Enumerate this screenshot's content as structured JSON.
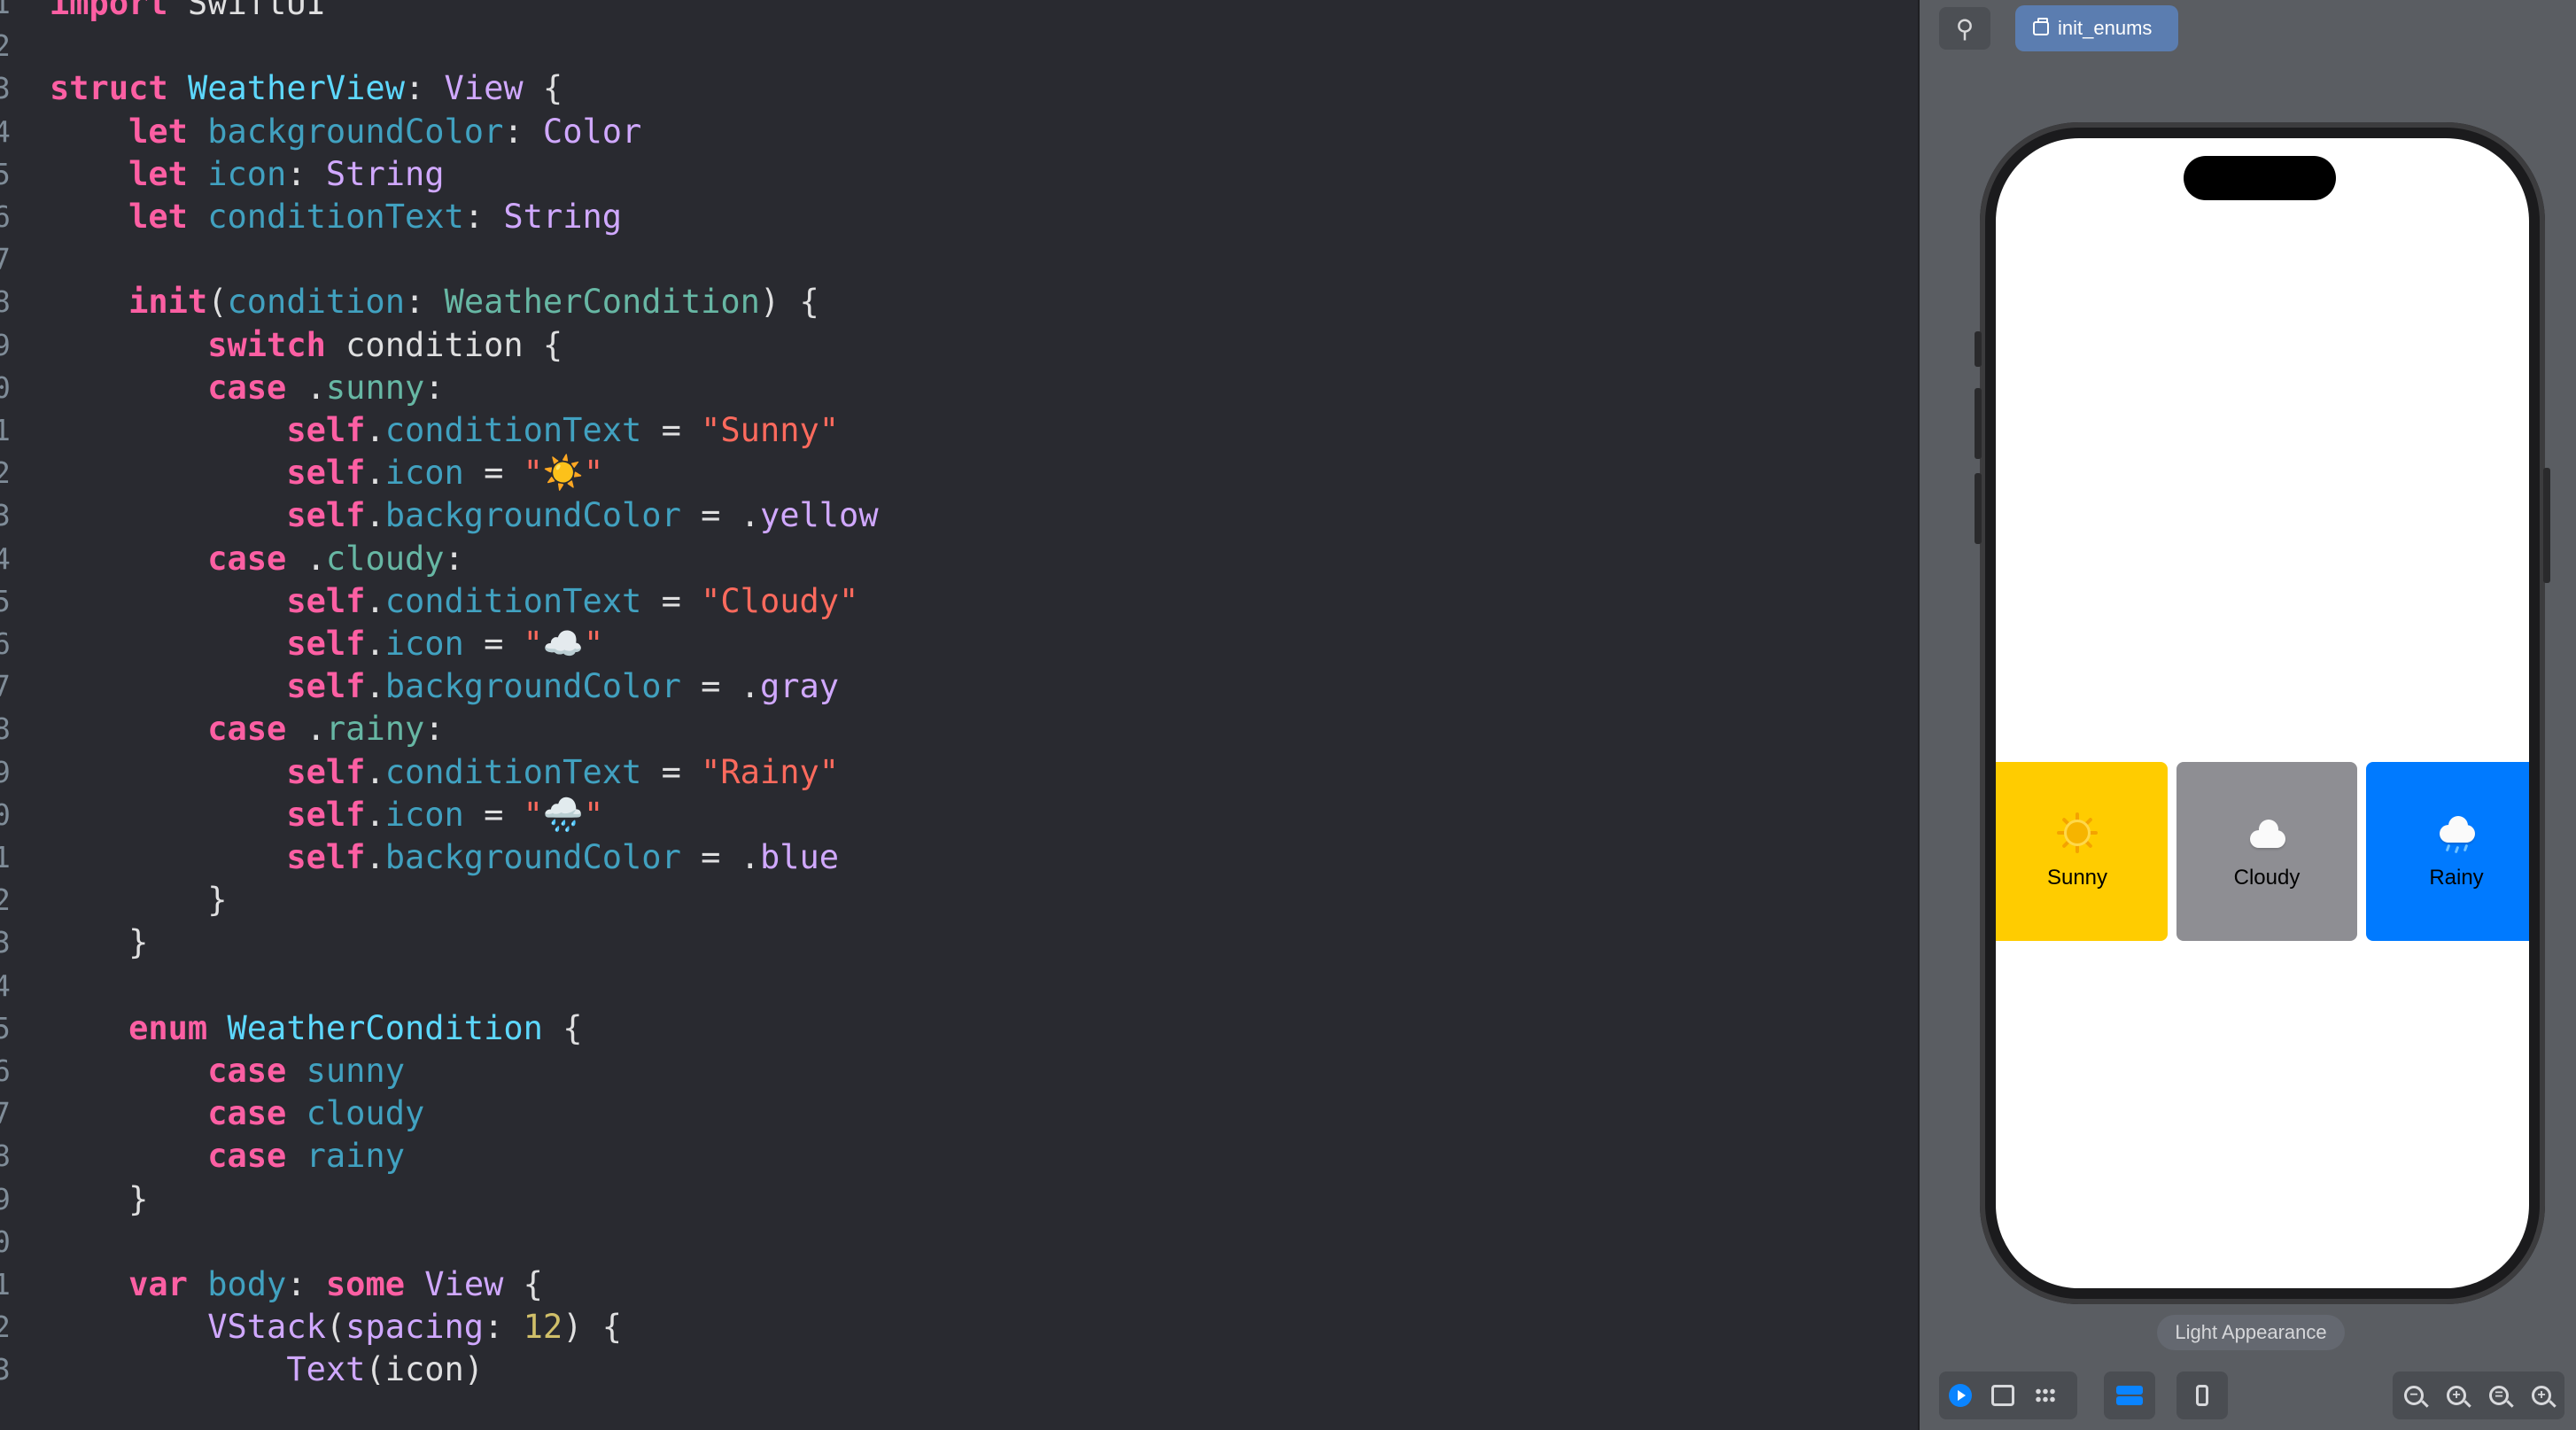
{
  "editor": {
    "lines": [
      {
        "num": "1",
        "parts": [
          {
            "t": "kw",
            "v": "import"
          },
          {
            "t": "pl",
            "v": " SwiftUI"
          }
        ]
      },
      {
        "num": "2",
        "parts": []
      },
      {
        "num": "3",
        "parts": [
          {
            "t": "kw",
            "v": "struct"
          },
          {
            "t": "pl",
            "v": " "
          },
          {
            "t": "tn",
            "v": "WeatherView"
          },
          {
            "t": "pl",
            "v": ": "
          },
          {
            "t": "ty",
            "v": "View"
          },
          {
            "t": "pl",
            "v": " {"
          }
        ]
      },
      {
        "num": "4",
        "parts": [
          {
            "t": "pl",
            "v": "    "
          },
          {
            "t": "kw",
            "v": "let"
          },
          {
            "t": "pl",
            "v": " "
          },
          {
            "t": "pr",
            "v": "backgroundColor"
          },
          {
            "t": "pl",
            "v": ": "
          },
          {
            "t": "ty",
            "v": "Color"
          }
        ]
      },
      {
        "num": "5",
        "parts": [
          {
            "t": "pl",
            "v": "    "
          },
          {
            "t": "kw",
            "v": "let"
          },
          {
            "t": "pl",
            "v": " "
          },
          {
            "t": "pr",
            "v": "icon"
          },
          {
            "t": "pl",
            "v": ": "
          },
          {
            "t": "ty",
            "v": "String"
          }
        ]
      },
      {
        "num": "6",
        "parts": [
          {
            "t": "pl",
            "v": "    "
          },
          {
            "t": "kw",
            "v": "let"
          },
          {
            "t": "pl",
            "v": " "
          },
          {
            "t": "pr",
            "v": "conditionText"
          },
          {
            "t": "pl",
            "v": ": "
          },
          {
            "t": "ty",
            "v": "String"
          }
        ]
      },
      {
        "num": "7",
        "parts": []
      },
      {
        "num": "8",
        "parts": [
          {
            "t": "pl",
            "v": "    "
          },
          {
            "t": "kw",
            "v": "init"
          },
          {
            "t": "pl",
            "v": "("
          },
          {
            "t": "pr",
            "v": "condition"
          },
          {
            "t": "pl",
            "v": ": "
          },
          {
            "t": "fn",
            "v": "WeatherCondition"
          },
          {
            "t": "pl",
            "v": ") {"
          }
        ]
      },
      {
        "num": "9",
        "parts": [
          {
            "t": "pl",
            "v": "        "
          },
          {
            "t": "kw",
            "v": "switch"
          },
          {
            "t": "pl",
            "v": " condition {"
          }
        ]
      },
      {
        "num": "0",
        "parts": [
          {
            "t": "pl",
            "v": "        "
          },
          {
            "t": "kw",
            "v": "case"
          },
          {
            "t": "pl",
            "v": " ."
          },
          {
            "t": "fn",
            "v": "sunny"
          },
          {
            "t": "pl",
            "v": ":"
          }
        ]
      },
      {
        "num": "1",
        "parts": [
          {
            "t": "pl",
            "v": "            "
          },
          {
            "t": "kw",
            "v": "self"
          },
          {
            "t": "pl",
            "v": "."
          },
          {
            "t": "pr",
            "v": "conditionText"
          },
          {
            "t": "pl",
            "v": " = "
          },
          {
            "t": "st",
            "v": "\"Sunny\""
          }
        ]
      },
      {
        "num": "2",
        "parts": [
          {
            "t": "pl",
            "v": "            "
          },
          {
            "t": "kw",
            "v": "self"
          },
          {
            "t": "pl",
            "v": "."
          },
          {
            "t": "pr",
            "v": "icon"
          },
          {
            "t": "pl",
            "v": " = "
          },
          {
            "t": "st",
            "v": "\"☀️\""
          }
        ]
      },
      {
        "num": "3",
        "parts": [
          {
            "t": "pl",
            "v": "            "
          },
          {
            "t": "kw",
            "v": "self"
          },
          {
            "t": "pl",
            "v": "."
          },
          {
            "t": "pr",
            "v": "backgroundColor"
          },
          {
            "t": "pl",
            "v": " = ."
          },
          {
            "t": "en",
            "v": "yellow"
          }
        ]
      },
      {
        "num": "4",
        "parts": [
          {
            "t": "pl",
            "v": "        "
          },
          {
            "t": "kw",
            "v": "case"
          },
          {
            "t": "pl",
            "v": " ."
          },
          {
            "t": "fn",
            "v": "cloudy"
          },
          {
            "t": "pl",
            "v": ":"
          }
        ]
      },
      {
        "num": "5",
        "parts": [
          {
            "t": "pl",
            "v": "            "
          },
          {
            "t": "kw",
            "v": "self"
          },
          {
            "t": "pl",
            "v": "."
          },
          {
            "t": "pr",
            "v": "conditionText"
          },
          {
            "t": "pl",
            "v": " = "
          },
          {
            "t": "st",
            "v": "\"Cloudy\""
          }
        ]
      },
      {
        "num": "6",
        "parts": [
          {
            "t": "pl",
            "v": "            "
          },
          {
            "t": "kw",
            "v": "self"
          },
          {
            "t": "pl",
            "v": "."
          },
          {
            "t": "pr",
            "v": "icon"
          },
          {
            "t": "pl",
            "v": " = "
          },
          {
            "t": "st",
            "v": "\"☁️\""
          }
        ]
      },
      {
        "num": "7",
        "parts": [
          {
            "t": "pl",
            "v": "            "
          },
          {
            "t": "kw",
            "v": "self"
          },
          {
            "t": "pl",
            "v": "."
          },
          {
            "t": "pr",
            "v": "backgroundColor"
          },
          {
            "t": "pl",
            "v": " = ."
          },
          {
            "t": "en",
            "v": "gray"
          }
        ]
      },
      {
        "num": "8",
        "parts": [
          {
            "t": "pl",
            "v": "        "
          },
          {
            "t": "kw",
            "v": "case"
          },
          {
            "t": "pl",
            "v": " ."
          },
          {
            "t": "fn",
            "v": "rainy"
          },
          {
            "t": "pl",
            "v": ":"
          }
        ]
      },
      {
        "num": "9",
        "parts": [
          {
            "t": "pl",
            "v": "            "
          },
          {
            "t": "kw",
            "v": "self"
          },
          {
            "t": "pl",
            "v": "."
          },
          {
            "t": "pr",
            "v": "conditionText"
          },
          {
            "t": "pl",
            "v": " = "
          },
          {
            "t": "st",
            "v": "\"Rainy\""
          }
        ]
      },
      {
        "num": "0",
        "parts": [
          {
            "t": "pl",
            "v": "            "
          },
          {
            "t": "kw",
            "v": "self"
          },
          {
            "t": "pl",
            "v": "."
          },
          {
            "t": "pr",
            "v": "icon"
          },
          {
            "t": "pl",
            "v": " = "
          },
          {
            "t": "st",
            "v": "\"🌧️\""
          }
        ]
      },
      {
        "num": "1",
        "parts": [
          {
            "t": "pl",
            "v": "            "
          },
          {
            "t": "kw",
            "v": "self"
          },
          {
            "t": "pl",
            "v": "."
          },
          {
            "t": "pr",
            "v": "backgroundColor"
          },
          {
            "t": "pl",
            "v": " = ."
          },
          {
            "t": "en",
            "v": "blue"
          }
        ]
      },
      {
        "num": "2",
        "parts": [
          {
            "t": "pl",
            "v": "        }"
          }
        ]
      },
      {
        "num": "3",
        "parts": [
          {
            "t": "pl",
            "v": "    }"
          }
        ]
      },
      {
        "num": "4",
        "parts": []
      },
      {
        "num": "5",
        "parts": [
          {
            "t": "pl",
            "v": "    "
          },
          {
            "t": "kw",
            "v": "enum"
          },
          {
            "t": "pl",
            "v": " "
          },
          {
            "t": "tn",
            "v": "WeatherCondition"
          },
          {
            "t": "pl",
            "v": " {"
          }
        ]
      },
      {
        "num": "6",
        "parts": [
          {
            "t": "pl",
            "v": "        "
          },
          {
            "t": "kw",
            "v": "case"
          },
          {
            "t": "pl",
            "v": " "
          },
          {
            "t": "pr",
            "v": "sunny"
          }
        ]
      },
      {
        "num": "7",
        "parts": [
          {
            "t": "pl",
            "v": "        "
          },
          {
            "t": "kw",
            "v": "case"
          },
          {
            "t": "pl",
            "v": " "
          },
          {
            "t": "pr",
            "v": "cloudy"
          }
        ]
      },
      {
        "num": "8",
        "parts": [
          {
            "t": "pl",
            "v": "        "
          },
          {
            "t": "kw",
            "v": "case"
          },
          {
            "t": "pl",
            "v": " "
          },
          {
            "t": "pr",
            "v": "rainy"
          }
        ]
      },
      {
        "num": "9",
        "parts": [
          {
            "t": "pl",
            "v": "    }"
          }
        ]
      },
      {
        "num": "0",
        "parts": []
      },
      {
        "num": "1",
        "parts": [
          {
            "t": "pl",
            "v": "    "
          },
          {
            "t": "kw",
            "v": "var"
          },
          {
            "t": "pl",
            "v": " "
          },
          {
            "t": "pr",
            "v": "body"
          },
          {
            "t": "pl",
            "v": ": "
          },
          {
            "t": "kw",
            "v": "some"
          },
          {
            "t": "pl",
            "v": " "
          },
          {
            "t": "ty",
            "v": "View"
          },
          {
            "t": "pl",
            "v": " {"
          }
        ]
      },
      {
        "num": "2",
        "parts": [
          {
            "t": "pl",
            "v": "        "
          },
          {
            "t": "ty",
            "v": "VStack"
          },
          {
            "t": "pl",
            "v": "("
          },
          {
            "t": "ty",
            "v": "spacing"
          },
          {
            "t": "pl",
            "v": ": "
          },
          {
            "t": "nu",
            "v": "12"
          },
          {
            "t": "pl",
            "v": ") {"
          }
        ]
      },
      {
        "num": "3",
        "parts": [
          {
            "t": "pl",
            "v": "            "
          },
          {
            "t": "ty",
            "v": "Text"
          },
          {
            "t": "pl",
            "v": "(icon)"
          }
        ]
      }
    ]
  },
  "canvas": {
    "pin_icon": "pin-icon",
    "preview_chip_label": "init_enums",
    "appearance_label": "Light Appearance",
    "tiles": [
      {
        "label": "Sunny",
        "icon": "sun-icon",
        "color": "#ffcc00"
      },
      {
        "label": "Cloudy",
        "icon": "cloud-icon",
        "color": "#8e8e93"
      },
      {
        "label": "Rainy",
        "icon": "rain-cloud-icon",
        "color": "#007aff"
      }
    ],
    "toolbar": {
      "left": [
        "live-preview-icon",
        "selectable-icon",
        "variants-grid-icon"
      ],
      "variant": "variant-icon",
      "device": "device-settings-icon",
      "zoom": [
        "zoom-out-icon",
        "zoom-in-icon",
        "zoom-fit-icon",
        "zoom-actual-icon"
      ]
    }
  }
}
